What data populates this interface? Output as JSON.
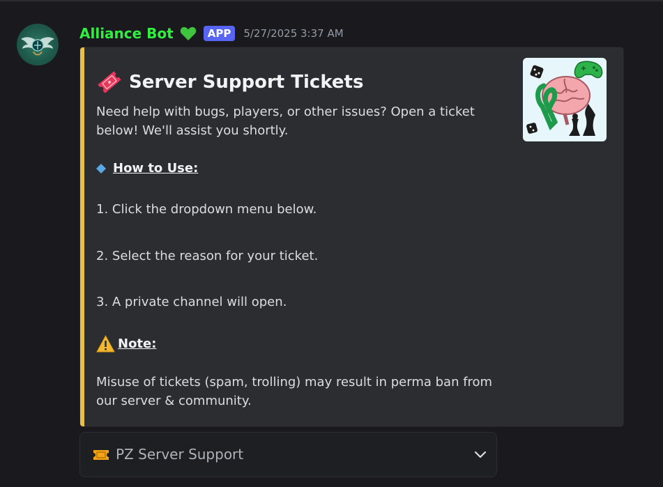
{
  "message": {
    "author": "Alliance Bot",
    "badge": "APP",
    "timestamp": "5/27/2025 3:37 AM"
  },
  "embed": {
    "title": "Server Support Tickets",
    "description": "Need help with bugs, players, or other issues? Open a ticket below! We'll assist you shortly.",
    "how_to_use_label": "How to Use:",
    "steps": [
      "1. Click the dropdown menu below.",
      "2. Select the reason for your ticket.",
      "3. A private channel will open."
    ],
    "note_label": "Note:",
    "note_text": "Misuse of tickets (spam, trolling) may result in perma ban from our server & community.",
    "accent_color": "#e8bf47"
  },
  "select_menu": {
    "selected": "PZ Server Support"
  },
  "colors": {
    "username": "#2ff03f",
    "badge_bg": "#5865f2",
    "background": "#1a1a1e",
    "embed_bg": "#2b2d31"
  }
}
